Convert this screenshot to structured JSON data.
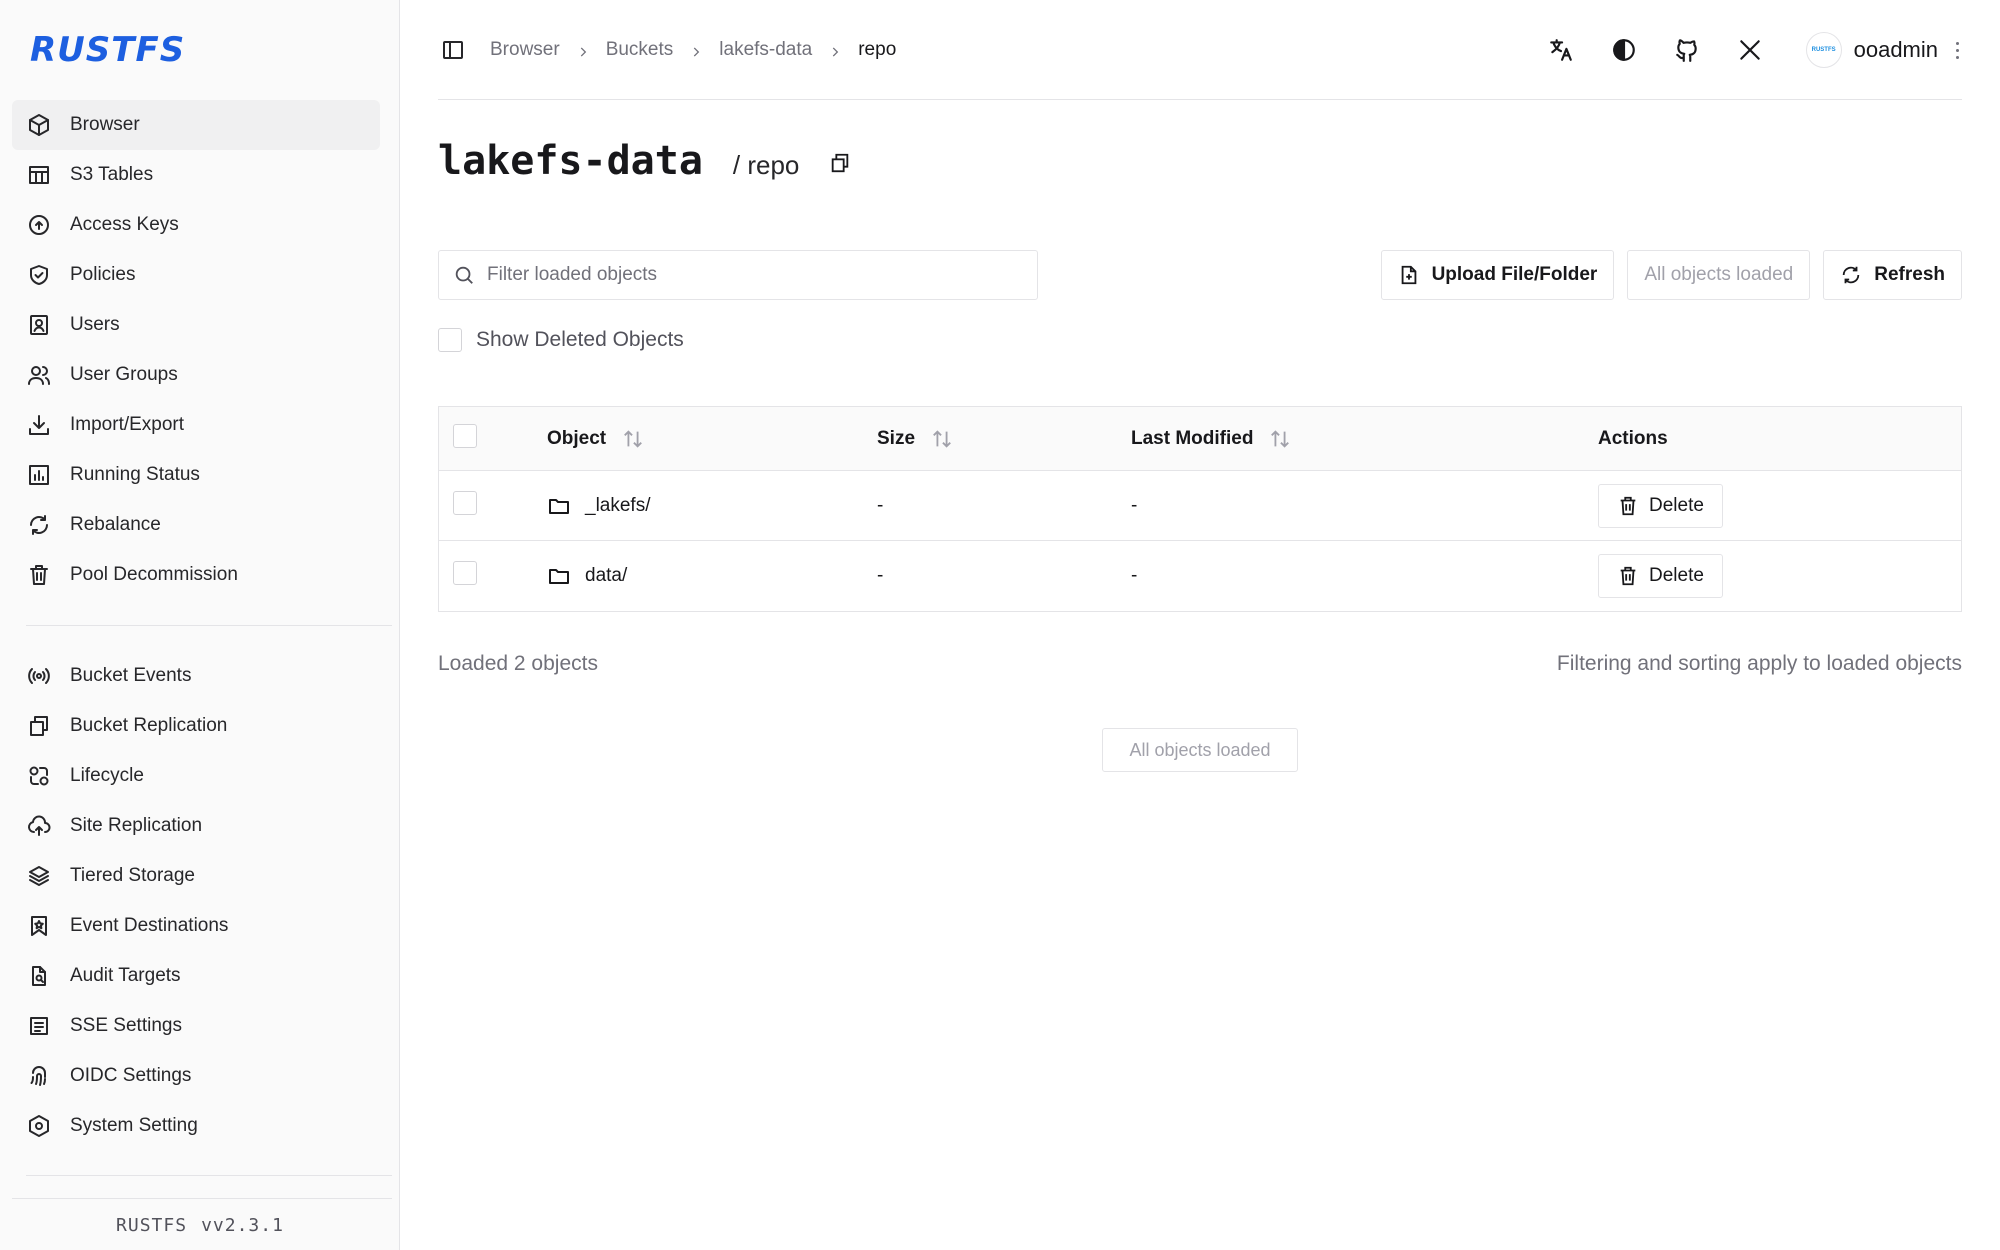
{
  "app": {
    "logo": "RUSTFS",
    "version_name": "RUSTFS",
    "version": "vv2.3.1"
  },
  "sidebar": {
    "items": [
      {
        "label": "Browser",
        "icon": "cube-icon",
        "active": true
      },
      {
        "label": "S3 Tables",
        "icon": "table-icon"
      },
      {
        "label": "Access Keys",
        "icon": "key-circle-icon"
      },
      {
        "label": "Policies",
        "icon": "shield-check-icon"
      },
      {
        "label": "Users",
        "icon": "user-badge-icon"
      },
      {
        "label": "User Groups",
        "icon": "users-icon"
      },
      {
        "label": "Import/Export",
        "icon": "download-icon"
      },
      {
        "label": "Running Status",
        "icon": "bar-chart-icon"
      },
      {
        "label": "Rebalance",
        "icon": "refresh-icon"
      },
      {
        "label": "Pool Decommission",
        "icon": "trash-icon"
      }
    ],
    "items2": [
      {
        "label": "Bucket Events",
        "icon": "broadcast-icon"
      },
      {
        "label": "Bucket Replication",
        "icon": "copy-icon"
      },
      {
        "label": "Lifecycle",
        "icon": "lifecycle-icon"
      },
      {
        "label": "Site Replication",
        "icon": "cloud-upload-icon"
      },
      {
        "label": "Tiered Storage",
        "icon": "layers-icon"
      },
      {
        "label": "Event Destinations",
        "icon": "bookmark-star-icon"
      },
      {
        "label": "Audit Targets",
        "icon": "file-search-icon"
      },
      {
        "label": "SSE Settings",
        "icon": "lock-file-icon"
      },
      {
        "label": "OIDC Settings",
        "icon": "fingerprint-icon"
      },
      {
        "label": "System Setting",
        "icon": "hexagon-gear-icon"
      }
    ]
  },
  "header": {
    "breadcrumb": [
      "Browser",
      "Buckets",
      "lakefs-data",
      "repo"
    ],
    "icons": [
      "translate-icon",
      "theme-icon",
      "github-icon",
      "x-icon"
    ],
    "avatar_text": "RUSTFS",
    "username": "ooadmin"
  },
  "page": {
    "bucket": "lakefs-data",
    "path": "/ repo"
  },
  "filter": {
    "placeholder": "Filter loaded objects"
  },
  "toolbar": {
    "upload": "Upload File/Folder",
    "all_loaded": "All objects loaded",
    "refresh": "Refresh"
  },
  "show_deleted": {
    "label": "Show Deleted Objects",
    "checked": false
  },
  "table": {
    "columns": [
      "Object",
      "Size",
      "Last Modified",
      "Actions"
    ],
    "rows": [
      {
        "name": "_lakefs/",
        "size": "-",
        "modified": "-",
        "action": "Delete"
      },
      {
        "name": "data/",
        "size": "-",
        "modified": "-",
        "action": "Delete"
      }
    ]
  },
  "footer": {
    "loaded": "Loaded 2 objects",
    "note": "Filtering and sorting apply to loaded objects",
    "all_loaded": "All objects loaded"
  },
  "colors": {
    "brand": "#1d5fe0",
    "border": "#e4e4e7",
    "muted": "#71717a"
  }
}
